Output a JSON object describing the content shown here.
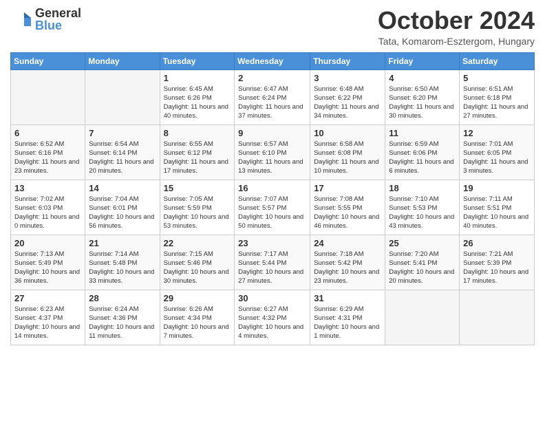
{
  "logo": {
    "general": "General",
    "blue": "Blue"
  },
  "title": "October 2024",
  "location": "Tata, Komarom-Esztergom, Hungary",
  "headers": [
    "Sunday",
    "Monday",
    "Tuesday",
    "Wednesday",
    "Thursday",
    "Friday",
    "Saturday"
  ],
  "weeks": [
    [
      {
        "day": "",
        "info": ""
      },
      {
        "day": "",
        "info": ""
      },
      {
        "day": "1",
        "info": "Sunrise: 6:45 AM\nSunset: 6:26 PM\nDaylight: 11 hours and 40 minutes."
      },
      {
        "day": "2",
        "info": "Sunrise: 6:47 AM\nSunset: 6:24 PM\nDaylight: 11 hours and 37 minutes."
      },
      {
        "day": "3",
        "info": "Sunrise: 6:48 AM\nSunset: 6:22 PM\nDaylight: 11 hours and 34 minutes."
      },
      {
        "day": "4",
        "info": "Sunrise: 6:50 AM\nSunset: 6:20 PM\nDaylight: 11 hours and 30 minutes."
      },
      {
        "day": "5",
        "info": "Sunrise: 6:51 AM\nSunset: 6:18 PM\nDaylight: 11 hours and 27 minutes."
      }
    ],
    [
      {
        "day": "6",
        "info": "Sunrise: 6:52 AM\nSunset: 6:16 PM\nDaylight: 11 hours and 23 minutes."
      },
      {
        "day": "7",
        "info": "Sunrise: 6:54 AM\nSunset: 6:14 PM\nDaylight: 11 hours and 20 minutes."
      },
      {
        "day": "8",
        "info": "Sunrise: 6:55 AM\nSunset: 6:12 PM\nDaylight: 11 hours and 17 minutes."
      },
      {
        "day": "9",
        "info": "Sunrise: 6:57 AM\nSunset: 6:10 PM\nDaylight: 11 hours and 13 minutes."
      },
      {
        "day": "10",
        "info": "Sunrise: 6:58 AM\nSunset: 6:08 PM\nDaylight: 11 hours and 10 minutes."
      },
      {
        "day": "11",
        "info": "Sunrise: 6:59 AM\nSunset: 6:06 PM\nDaylight: 11 hours and 6 minutes."
      },
      {
        "day": "12",
        "info": "Sunrise: 7:01 AM\nSunset: 6:05 PM\nDaylight: 11 hours and 3 minutes."
      }
    ],
    [
      {
        "day": "13",
        "info": "Sunrise: 7:02 AM\nSunset: 6:03 PM\nDaylight: 11 hours and 0 minutes."
      },
      {
        "day": "14",
        "info": "Sunrise: 7:04 AM\nSunset: 6:01 PM\nDaylight: 10 hours and 56 minutes."
      },
      {
        "day": "15",
        "info": "Sunrise: 7:05 AM\nSunset: 5:59 PM\nDaylight: 10 hours and 53 minutes."
      },
      {
        "day": "16",
        "info": "Sunrise: 7:07 AM\nSunset: 5:57 PM\nDaylight: 10 hours and 50 minutes."
      },
      {
        "day": "17",
        "info": "Sunrise: 7:08 AM\nSunset: 5:55 PM\nDaylight: 10 hours and 46 minutes."
      },
      {
        "day": "18",
        "info": "Sunrise: 7:10 AM\nSunset: 5:53 PM\nDaylight: 10 hours and 43 minutes."
      },
      {
        "day": "19",
        "info": "Sunrise: 7:11 AM\nSunset: 5:51 PM\nDaylight: 10 hours and 40 minutes."
      }
    ],
    [
      {
        "day": "20",
        "info": "Sunrise: 7:13 AM\nSunset: 5:49 PM\nDaylight: 10 hours and 36 minutes."
      },
      {
        "day": "21",
        "info": "Sunrise: 7:14 AM\nSunset: 5:48 PM\nDaylight: 10 hours and 33 minutes."
      },
      {
        "day": "22",
        "info": "Sunrise: 7:15 AM\nSunset: 5:46 PM\nDaylight: 10 hours and 30 minutes."
      },
      {
        "day": "23",
        "info": "Sunrise: 7:17 AM\nSunset: 5:44 PM\nDaylight: 10 hours and 27 minutes."
      },
      {
        "day": "24",
        "info": "Sunrise: 7:18 AM\nSunset: 5:42 PM\nDaylight: 10 hours and 23 minutes."
      },
      {
        "day": "25",
        "info": "Sunrise: 7:20 AM\nSunset: 5:41 PM\nDaylight: 10 hours and 20 minutes."
      },
      {
        "day": "26",
        "info": "Sunrise: 7:21 AM\nSunset: 5:39 PM\nDaylight: 10 hours and 17 minutes."
      }
    ],
    [
      {
        "day": "27",
        "info": "Sunrise: 6:23 AM\nSunset: 4:37 PM\nDaylight: 10 hours and 14 minutes."
      },
      {
        "day": "28",
        "info": "Sunrise: 6:24 AM\nSunset: 4:36 PM\nDaylight: 10 hours and 11 minutes."
      },
      {
        "day": "29",
        "info": "Sunrise: 6:26 AM\nSunset: 4:34 PM\nDaylight: 10 hours and 7 minutes."
      },
      {
        "day": "30",
        "info": "Sunrise: 6:27 AM\nSunset: 4:32 PM\nDaylight: 10 hours and 4 minutes."
      },
      {
        "day": "31",
        "info": "Sunrise: 6:29 AM\nSunset: 4:31 PM\nDaylight: 10 hours and 1 minute."
      },
      {
        "day": "",
        "info": ""
      },
      {
        "day": "",
        "info": ""
      }
    ]
  ]
}
